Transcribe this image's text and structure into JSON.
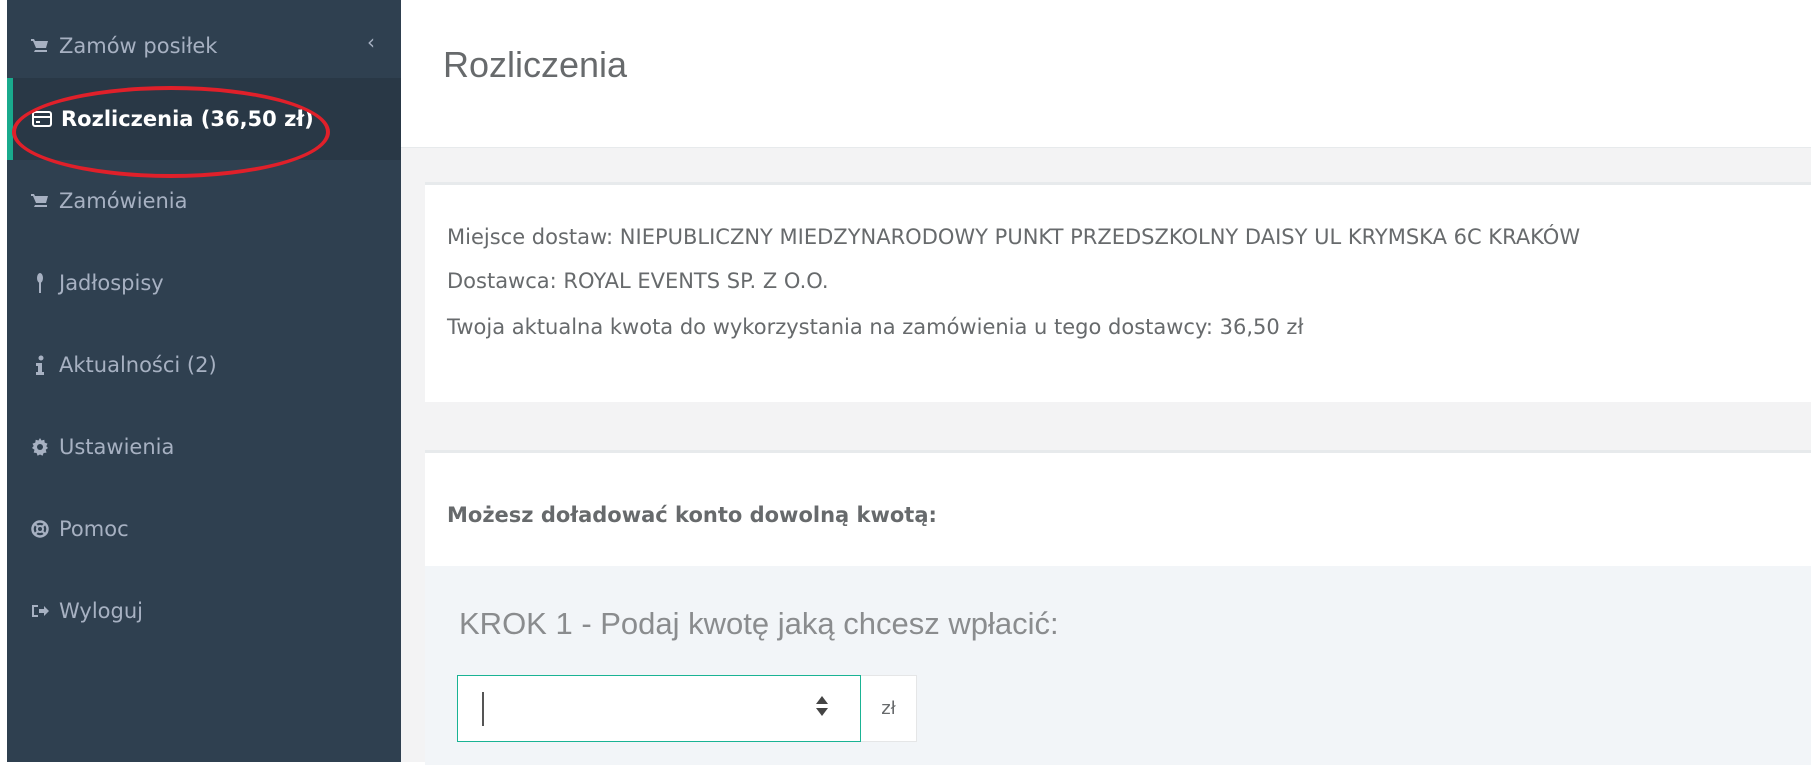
{
  "sidebar": {
    "collapse_arrow": "‹",
    "items": [
      {
        "label": "Zamów posiłek",
        "icon": "cart-icon"
      },
      {
        "label": "Rozliczenia (36,50 zł)",
        "icon": "credit-card-icon"
      },
      {
        "label": "Zamówienia",
        "icon": "cart-icon"
      },
      {
        "label": "Jadłospisy",
        "icon": "cutlery-icon"
      },
      {
        "label": "Aktualności (2)",
        "icon": "info-icon"
      },
      {
        "label": "Ustawienia",
        "icon": "gear-icon"
      },
      {
        "label": "Pomoc",
        "icon": "life-ring-icon"
      },
      {
        "label": "Wyloguj",
        "icon": "sign-out-icon"
      }
    ]
  },
  "header": {
    "title": "Rozliczenia"
  },
  "info": {
    "place": "Miejsce dostaw: NIEPUBLICZNY MIEDZYNARODOWY PUNKT PRZEDSZKOLNY DAISY UL KRYMSKA 6C KRAKÓW",
    "supplier": "Dostawca: ROYAL EVENTS SP. Z O.O.",
    "balance": "Twoja aktualna kwota do wykorzystania na zamówienia u tego dostawcy: 36,50 zł"
  },
  "topup": {
    "title": "Możesz doładować konto dowolną kwotą:",
    "step1_label": "KROK 1 - Podaj kwotę jaką chcesz wpłacić:",
    "amount_value": "",
    "currency": "zł"
  },
  "colors": {
    "sidebar_bg": "#2f4050",
    "active_bg": "#293846",
    "accent": "#19aa8d",
    "highlight": "#e0202a"
  }
}
